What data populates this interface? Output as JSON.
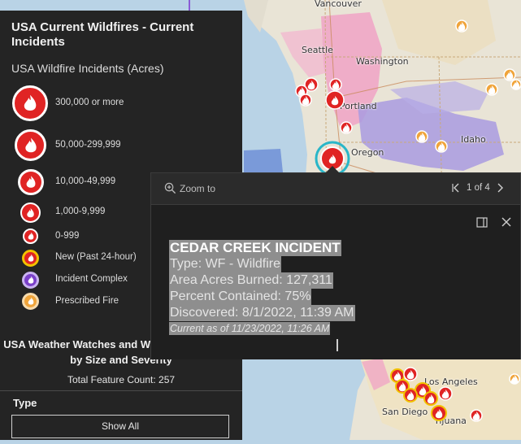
{
  "legend": {
    "title": "USA Current Wildfires - Current Incidents",
    "subtitle": "USA Wildfire Incidents (Acres)",
    "items": [
      {
        "label": "300,000 or more",
        "icon": "flame-icon",
        "ring": "#d61f1f",
        "fill": "#e02424"
      },
      {
        "label": "50,000-299,999",
        "icon": "flame-icon",
        "ring": "#d61f1f",
        "fill": "#e02424"
      },
      {
        "label": "10,000-49,999",
        "icon": "flame-icon",
        "ring": "#d61f1f",
        "fill": "#e02424"
      },
      {
        "label": "1,000-9,999",
        "icon": "flame-icon",
        "ring": "#d61f1f",
        "fill": "#e02424"
      },
      {
        "label": "0-999",
        "icon": "flame-icon",
        "ring": "#d61f1f",
        "fill": "#e02424"
      },
      {
        "label": "New (Past 24-hour)",
        "icon": "flame-icon",
        "ring": "#f2c200",
        "fill": "#e02424"
      },
      {
        "label": "Incident Complex",
        "icon": "flame-icon",
        "ring": "#8a5bd6",
        "fill": "#7a3fc9"
      },
      {
        "label": "Prescribed Fire",
        "icon": "flame-icon",
        "ring": "#f4c98a",
        "fill": "#f0a43a"
      }
    ],
    "weather_title": "USA Weather Watches and Warnings - Ordered by Size and Severity",
    "total_count": "Total Feature Count: 257",
    "type_label": "Type",
    "show_all": "Show All"
  },
  "popup": {
    "zoom_label": "Zoom to",
    "page_text": "1 of 4",
    "incident_title": "CEDAR CREEK INCIDENT",
    "type": "Type: WF - Wildfire",
    "acres": "Area Acres Burned: 127,311",
    "contained": "Percent Contained: 75%",
    "discovered": "Discovered: 8/1/2022, 11:39 AM",
    "as_of": "Current as of 11/23/2022, 11:26 AM"
  },
  "map": {
    "places": {
      "vancouver": "Vancouver",
      "seattle": "Seattle",
      "washington": "Washington",
      "portland": "Portland",
      "oregon": "Oregon",
      "idaho": "Idaho",
      "los_angeles": "Los Angeles",
      "san_diego": "San Diego",
      "tijuana": "Tijuana"
    },
    "colors": {
      "water": "#b9d3e6",
      "land": "#e9e4d6",
      "warning_pink": "#f0a3c5",
      "warning_purple": "#a99be0",
      "warning_blue": "#6f8fd6",
      "fire_red": "#e02424"
    }
  }
}
